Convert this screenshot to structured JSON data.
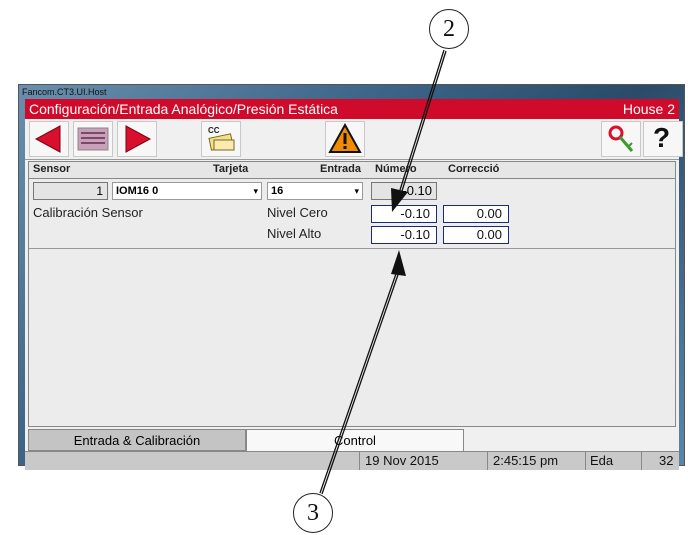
{
  "callouts": {
    "top": "2",
    "bottom": "3"
  },
  "window": {
    "title": "Fancom.CT3.UI.Host"
  },
  "header": {
    "path": "Configuración/Entrada Analógico/Presión Estática",
    "house": "House 2"
  },
  "toolbar": {
    "cc_label": "CC",
    "help_label": "?"
  },
  "columns": {
    "sensor": "Sensor",
    "tarjeta": "Tarjeta",
    "entrada": "Entrada",
    "numero": "Número",
    "correccion": "Correcció"
  },
  "sensor_row": {
    "index": "1",
    "tarjeta": "IOM16 0",
    "entrada": "16",
    "numero_value": "-0.10"
  },
  "calibration": {
    "label": "Calibración Sensor",
    "zero": {
      "label": "Nivel Cero",
      "value": "-0.10",
      "correction": "0.00"
    },
    "high": {
      "label": "Nivel Alto",
      "value": "-0.10",
      "correction": "0.00"
    }
  },
  "tabs": [
    {
      "label": "Entrada & Calibración"
    },
    {
      "label": "Control"
    }
  ],
  "status": {
    "date": "19 Nov 2015",
    "time": "2:45:15 pm",
    "user": "Eda",
    "number": "32"
  },
  "colors": {
    "header": "#d00a2a",
    "arrow_red": "#d8102e",
    "warning_orange": "#f08a00"
  }
}
